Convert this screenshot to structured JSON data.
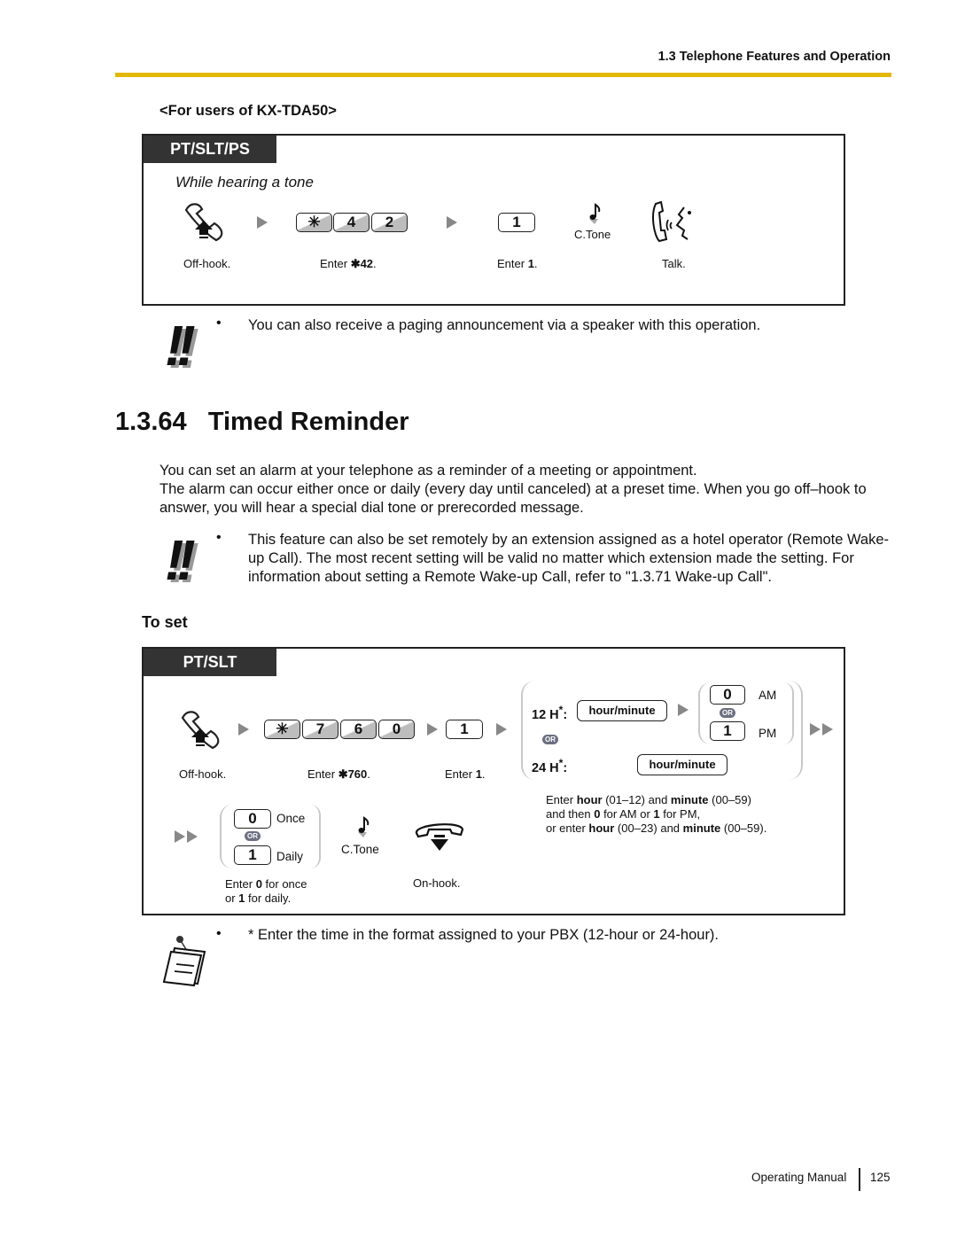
{
  "header": {
    "section_title": "1.3 Telephone Features and Operation",
    "accent_color": "#e3b800"
  },
  "tda50": {
    "subheading": "<For users of KX-TDA50>",
    "box_tab": "PT/SLT/PS",
    "condition": "While hearing a tone",
    "keys": [
      "✳",
      "4",
      "2"
    ],
    "key_one": "1",
    "tone_label": "C.Tone",
    "steps": [
      {
        "icon": "off-hook-icon",
        "caption_pre": "Off-hook.",
        "caption_bold": "",
        "caption_post": ""
      },
      {
        "icon": "keypad",
        "caption_pre": "Enter ",
        "caption_bold": "✱42",
        "caption_post": "."
      },
      {
        "icon": "keypad",
        "caption_pre": "Enter ",
        "caption_bold": "1",
        "caption_post": "."
      },
      {
        "icon": "talk-icon",
        "caption_pre": "Talk.",
        "caption_bold": "",
        "caption_post": ""
      }
    ],
    "note": "You can also receive a paging announcement via a speaker with this operation."
  },
  "section": {
    "number": "1.3.64",
    "title": "Timed Reminder",
    "paragraphs": [
      "You can set an alarm at your telephone as a reminder of a meeting or appointment.",
      "The alarm can occur either once or daily (every day until canceled) at a preset time. When you go off–hook to answer, you will hear a special dial tone or prerecorded message."
    ],
    "note": "This feature can also be set remotely by an extension assigned as a hotel operator (Remote Wake-up Call). The most recent setting will be valid no matter which extension made the setting. For information about setting a Remote Wake-up Call, refer to \"1.3.71 Wake-up Call\"."
  },
  "to_set": {
    "heading": "To set",
    "box_tab": "PT/SLT",
    "keys": [
      "✳",
      "7",
      "6",
      "0"
    ],
    "key_one": "1",
    "captions": {
      "offhook": "Off-hook.",
      "enter760_pre": "Enter ",
      "enter760_bold": "✱760",
      "enter1_pre": "Enter ",
      "enter1_bold": "1",
      "period": "."
    },
    "time": {
      "h12_label": "12 H",
      "h24_label": "24 H",
      "asterisk": "*",
      "colon": ":",
      "hour_minute": "hour/minute",
      "am_key": "0",
      "am_label": "AM",
      "pm_key": "1",
      "pm_label": "PM",
      "or_label": "OR",
      "help_line1": [
        "Enter ",
        "hour",
        " (01–12) and ",
        "minute",
        " (00–59)"
      ],
      "help_line2": [
        "and then ",
        "0",
        " for AM or ",
        "1",
        " for PM,"
      ],
      "help_line3": [
        "or enter ",
        "hour",
        " (00–23) and ",
        "minute",
        " (00–59)."
      ]
    },
    "repeat": {
      "once_key": "0",
      "once_label": "Once",
      "daily_key": "1",
      "daily_label": "Daily",
      "or_label": "OR",
      "caption_line1": [
        "Enter ",
        "0",
        " for once"
      ],
      "caption_line2": [
        "or ",
        "1",
        " for daily."
      ]
    },
    "tone_label": "C.Tone",
    "onhook": "On-hook.",
    "footnote": "* Enter the time in the format assigned to your PBX (12-hour or 24-hour)."
  },
  "bullet_char": "•",
  "bang": "!!",
  "footer": {
    "manual": "Operating Manual",
    "page": "125"
  }
}
